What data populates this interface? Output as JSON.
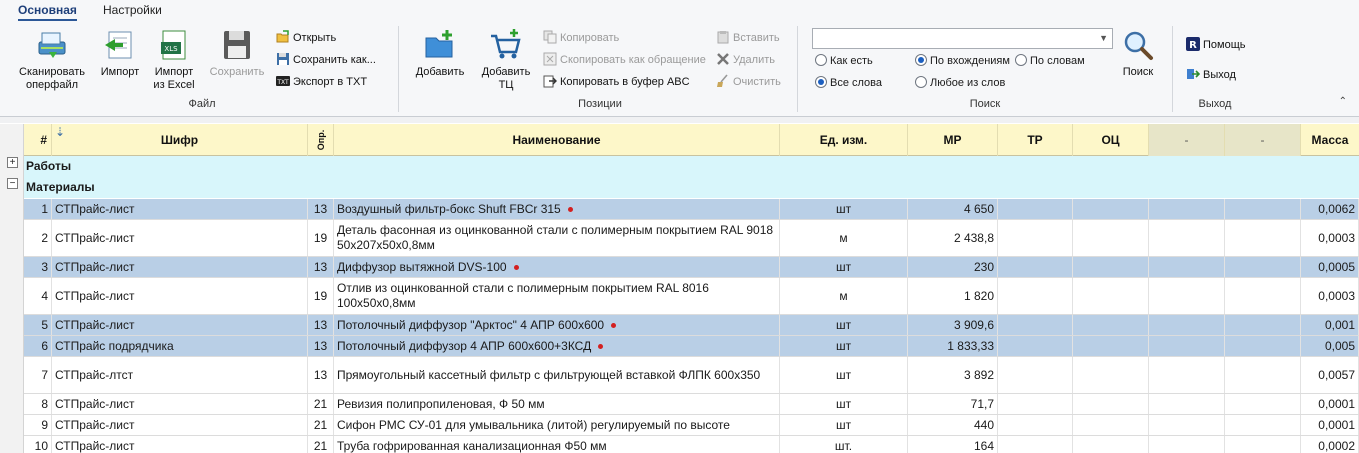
{
  "tabs": [
    {
      "label": "Основная",
      "active": true
    },
    {
      "label": "Настройки",
      "active": false
    }
  ],
  "ribbon": {
    "file": {
      "title": "Файл",
      "scan": "Сканировать\nоперфайл",
      "import": "Импорт",
      "import_excel": "Импорт\nиз Excel",
      "save": "Сохранить",
      "open": "Открыть",
      "save_as": "Сохранить как...",
      "export_txt": "Экспорт в TXT"
    },
    "positions": {
      "title": "Позиции",
      "add": "Добавить",
      "add_tc": "Добавить\nТЦ",
      "copy": "Копировать",
      "copy_as_ref": "Скопировать как обращение",
      "copy_abc": "Копировать в буфер ABC",
      "paste": "Вставить",
      "delete": "Удалить",
      "clear": "Очистить"
    },
    "search": {
      "title": "Поиск",
      "combo_value": "",
      "opt_as_is": "Как есть",
      "opt_all_words": "Все слова",
      "opt_by_entry": "По вхождениям",
      "opt_by_words": "По словам",
      "opt_any_word": "Любое из слов",
      "search_button": "Поиск",
      "selected": [
        "opt_all_words",
        "opt_by_entry"
      ]
    },
    "exit": {
      "title": "Выход",
      "help": "Помощь",
      "exit": "Выход"
    }
  },
  "grid": {
    "columns": {
      "num": "#",
      "cipher": "Шифр",
      "opr": "Опр.",
      "name": "Наименование",
      "unit": "Ед. изм.",
      "mr": "МР",
      "tr": "ТР",
      "oc": "ОЦ",
      "dash1": "-",
      "dash2": "-",
      "mass": "Масса"
    },
    "groups": {
      "works": "Работы",
      "materials": "Материалы"
    },
    "rows": [
      {
        "num": "1",
        "cipher": "СТПрайс-лист",
        "opr": "13",
        "name": "Воздушный фильтр-бокс Shuft  FBCr 315",
        "dot": true,
        "unit": "шт",
        "mr": "4 650",
        "mass": "0,0062"
      },
      {
        "num": "2",
        "cipher": "СТПрайс-лист",
        "opr": "19",
        "name": "Деталь фасонная из оцинкованной стали с полимерным покрытием RAL 9018 50x207x50x0,8мм",
        "dot": false,
        "unit": "м",
        "mr": "2 438,8",
        "mass": "0,0003"
      },
      {
        "num": "3",
        "cipher": "СТПрайс-лист",
        "opr": "13",
        "name": "Диффузор вытяжной DVS-100",
        "dot": true,
        "unit": "шт",
        "mr": "230",
        "mass": "0,0005"
      },
      {
        "num": "4",
        "cipher": "СТПрайс-лист",
        "opr": "19",
        "name": "Отлив из оцинкованной стали с полимерным покрытием RAL 8016 100x50x0,8мм",
        "dot": false,
        "unit": "м",
        "mr": "1 820",
        "mass": "0,0003"
      },
      {
        "num": "5",
        "cipher": "СТПрайс-лист",
        "opr": "13",
        "name": "Потолочный диффузор \"Арктос\" 4 АПР 600х600",
        "dot": true,
        "unit": "шт",
        "mr": "3 909,6",
        "mass": "0,001"
      },
      {
        "num": "6",
        "cipher": "СТПрайс подрядчика",
        "opr": "13",
        "name": "Потолочный диффузор 4 АПР 600х600+3КСД",
        "dot": true,
        "unit": "шт",
        "mr": "1 833,33",
        "mass": "0,005"
      },
      {
        "num": "7",
        "cipher": "СТПрайс-лтст",
        "opr": "13",
        "name": "Прямоугольный кассетный фильтр с фильтрующей вставкой ФЛПК 600x350",
        "dot": false,
        "unit": "шт",
        "mr": "3 892",
        "mass": "0,0057"
      },
      {
        "num": "8",
        "cipher": "СТПрайс-лист",
        "opr": "21",
        "name": "Ревизия полипропиленовая, Ф 50 мм",
        "dot": false,
        "unit": "шт",
        "mr": "71,7",
        "mass": "0,0001"
      },
      {
        "num": "9",
        "cipher": "СТПрайс-лист",
        "opr": "21",
        "name": "Сифон РМС СУ-01 для умывальника (литой) регулируемый по высоте",
        "dot": false,
        "unit": "шт",
        "mr": "440",
        "mass": "0,0001"
      },
      {
        "num": "10",
        "cipher": "СТПрайс-лист",
        "opr": "21",
        "name": "Труба гофрированная канализационная Ф50 мм",
        "dot": false,
        "unit": "шт.",
        "mr": "164",
        "mass": "0,0002"
      }
    ]
  }
}
